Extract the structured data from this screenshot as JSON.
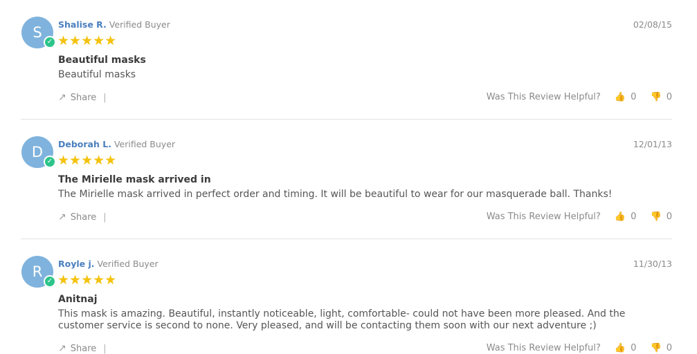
{
  "colors": {
    "accent": "#4a7fbe",
    "star": "#f4c20d",
    "avatar_bg": "#7fb3dd",
    "verified_badge": "#2dc48a"
  },
  "icons": {
    "star": "★",
    "share": "share-icon",
    "thumbs_up": "thumbs-up-icon",
    "thumbs_down": "thumbs-down-icon",
    "check": "check-icon"
  },
  "labels": {
    "share": "Share",
    "helpful_question": "Was This Review Helpful?",
    "separator": "|"
  },
  "reviews": [
    {
      "initial": "S",
      "name": "Shalise R.",
      "verified": "Verified Buyer",
      "date": "02/08/15",
      "rating": 5,
      "stars": "★★★★★",
      "title": "Beautiful masks",
      "body": "Beautiful masks",
      "helpful_up": "0",
      "helpful_down": "0"
    },
    {
      "initial": "D",
      "name": "Deborah L.",
      "verified": "Verified Buyer",
      "date": "12/01/13",
      "rating": 5,
      "stars": "★★★★★",
      "title": "The Mirielle mask arrived in",
      "body": "The Mirielle mask arrived in perfect order and timing. It will be beautiful to wear for our masquerade ball. Thanks!",
      "helpful_up": "0",
      "helpful_down": "0"
    },
    {
      "initial": "R",
      "name": "Royle j.",
      "verified": "Verified Buyer",
      "date": "11/30/13",
      "rating": 5,
      "stars": "★★★★★",
      "title": "Anitnaj",
      "body": "This mask is amazing. Beautiful, instantly noticeable, light, comfortable- could not have been more pleased. And the customer service is second to none. Very pleased, and will be contacting them soon with our next adventure ;)",
      "helpful_up": "0",
      "helpful_down": "0"
    }
  ]
}
